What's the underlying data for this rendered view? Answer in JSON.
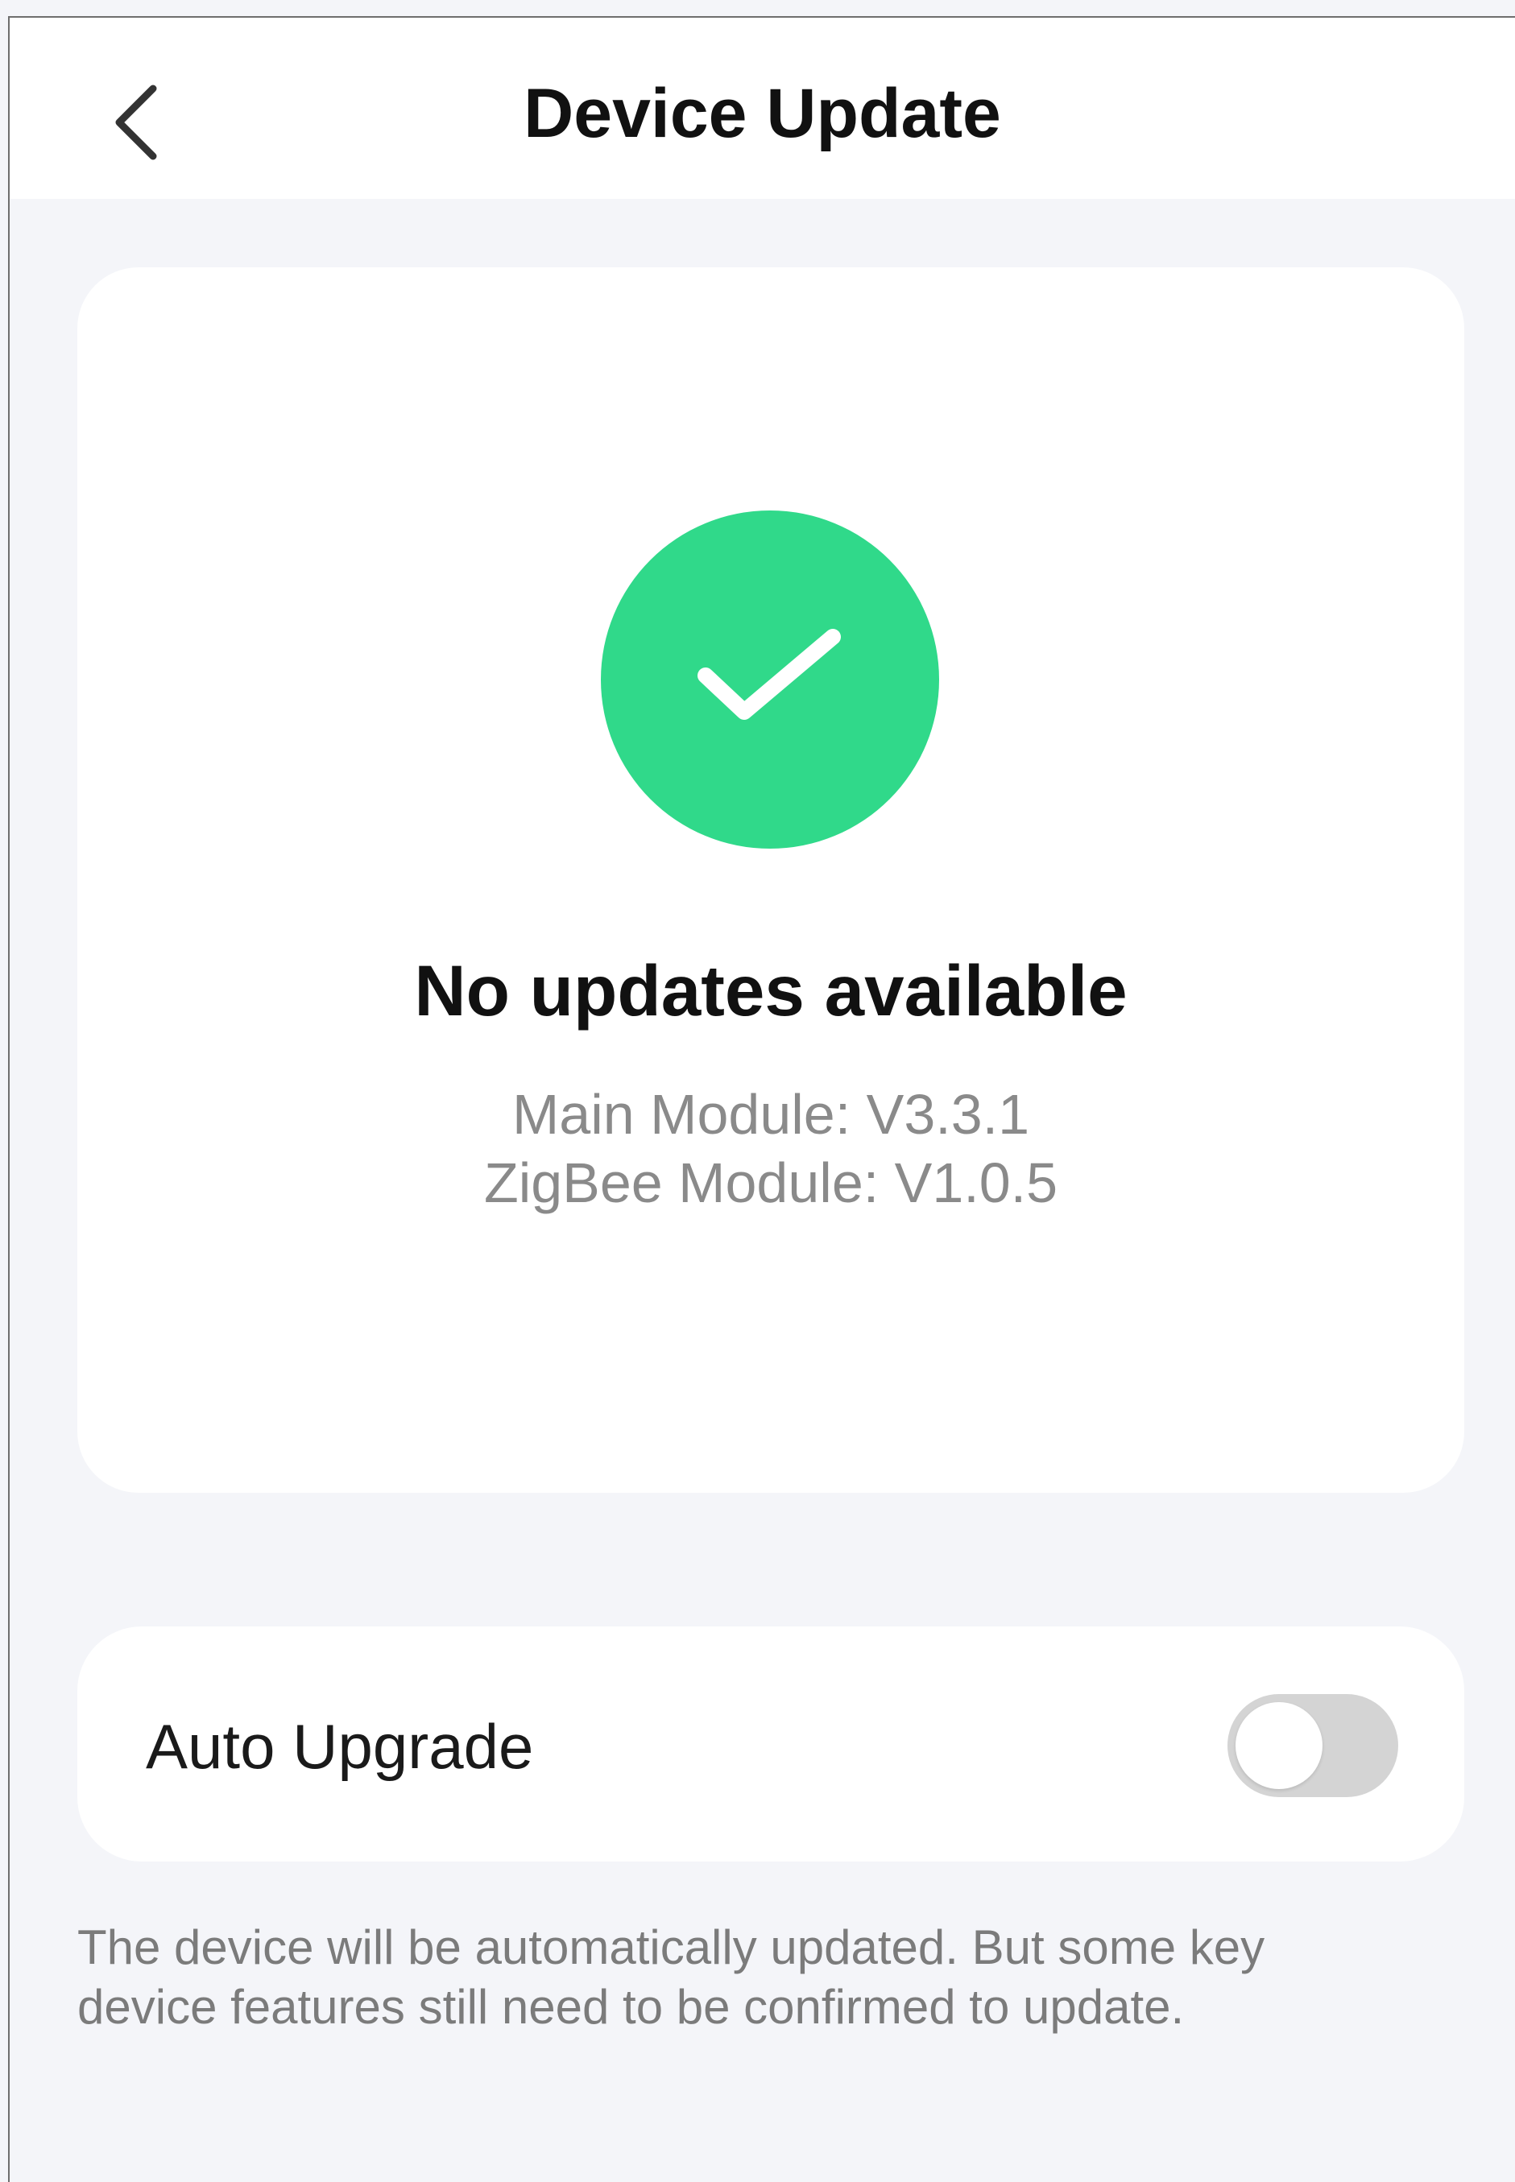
{
  "header": {
    "title": "Device Update",
    "back_icon": "chevron-left-icon"
  },
  "status": {
    "icon": "check-circle-icon",
    "icon_color": "#30d98a",
    "heading": "No updates available",
    "main_module": "Main Module: V3.3.1",
    "zigbee_module": "ZigBee Module: V1.0.5"
  },
  "settings": {
    "auto_upgrade_label": "Auto Upgrade",
    "auto_upgrade_enabled": false,
    "toggle_off_color": "#d4d4d4"
  },
  "note": "The device will be automatically updated. But some key device features still need to be confirmed to update.",
  "colors": {
    "background": "#f4f5f9",
    "card": "#ffffff",
    "success": "#30d98a"
  }
}
